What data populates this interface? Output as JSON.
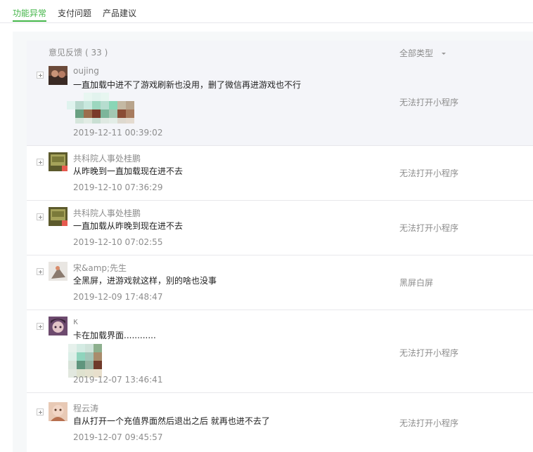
{
  "tabs": [
    {
      "label": "功能异常",
      "active": true
    },
    {
      "label": "支付问题",
      "active": false
    },
    {
      "label": "产品建议",
      "active": false
    }
  ],
  "colors": {
    "accent": "#44b549",
    "row_highlight": "#f4f5f9",
    "muted": "#8d8d8d"
  },
  "header": {
    "title": "意见反馈",
    "count": "( 33 )",
    "filter_label": "全部类型"
  },
  "feedback": [
    {
      "nickname": "oujing",
      "content": "一直加载中进不了游戏刷新也没用，删了微信再进游戏也不行",
      "time": "2019-12-11 00:39:02",
      "category": "无法打开小程序",
      "has_image": true
    },
    {
      "nickname": "共科院人事处桂鹏",
      "content": "从昨晚到一直加载现在进不去",
      "time": "2019-12-10 07:36:29",
      "category": "无法打开小程序",
      "has_image": false
    },
    {
      "nickname": "共科院人事处桂鹏",
      "content": "一直加载从昨晚到现在进不去",
      "time": "2019-12-10 07:02:55",
      "category": "无法打开小程序",
      "has_image": false
    },
    {
      "nickname": "宋&amp;先生",
      "content": "全黑屏，进游戏就这样，别的啥也没事",
      "time": "2019-12-09 17:48:47",
      "category": "黑屏白屏",
      "has_image": false
    },
    {
      "nickname": "κ",
      "content": "卡在加载界面............",
      "time": "2019-12-07 13:46:41",
      "category": "无法打开小程序",
      "has_image": true
    },
    {
      "nickname": "程云涛",
      "content": "自从打开一个充值界面然后退出之后 就再也进不去了",
      "time": "2019-12-07 09:45:57",
      "category": "无法打开小程序",
      "has_image": false
    }
  ]
}
